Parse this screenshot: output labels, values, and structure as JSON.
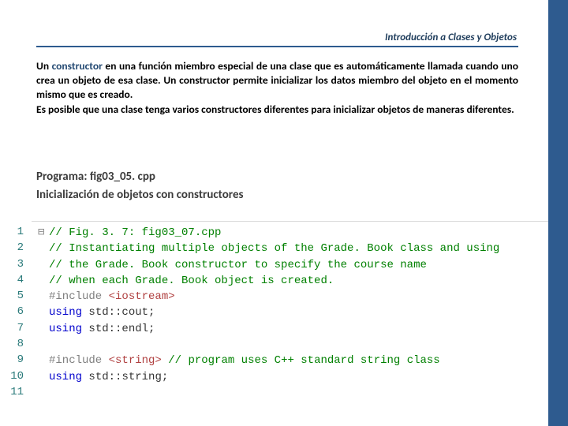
{
  "header": {
    "title": "Introducción a Clases y Objetos"
  },
  "body": {
    "p1_pre": "Un ",
    "p1_term": "constructor",
    "p1_post": " en una función miembro especial de una clase que es automáticamente llamada cuando uno crea un objeto de esa clase. Un constructor permite inicializar los datos miembro del objeto en el momento mismo que es creado.",
    "p2": "Es posible que una clase tenga varios constructores diferentes para inicializar objetos de maneras diferentes."
  },
  "program": {
    "title": "Programa: fig03_05. cpp",
    "subtitle": "Inicialización de objetos con constructores"
  },
  "code": {
    "gutter": [
      "1",
      "2",
      "3",
      "4",
      "5",
      "6",
      "7",
      "8",
      "9",
      "10",
      "11"
    ],
    "lines": [
      {
        "fold": "⊟",
        "segments": [
          {
            "cls": "comment",
            "t": "// Fig. 3. 7: fig03_07.cpp"
          }
        ]
      },
      {
        "fold": " ",
        "segments": [
          {
            "cls": "comment",
            "t": "// Instantiating multiple objects of the Grade. Book class and using"
          }
        ]
      },
      {
        "fold": " ",
        "segments": [
          {
            "cls": "comment",
            "t": "// the Grade. Book constructor to specify the course name"
          }
        ]
      },
      {
        "fold": " ",
        "segments": [
          {
            "cls": "comment",
            "t": "// when each Grade. Book object is created."
          }
        ]
      },
      {
        "fold": " ",
        "segments": [
          {
            "cls": "pp",
            "t": "#include "
          },
          {
            "cls": "str",
            "t": "<iostream>"
          }
        ]
      },
      {
        "fold": " ",
        "segments": [
          {
            "cls": "kw",
            "t": "using"
          },
          {
            "cls": "",
            "t": " std::cout;"
          }
        ]
      },
      {
        "fold": " ",
        "segments": [
          {
            "cls": "kw",
            "t": "using"
          },
          {
            "cls": "",
            "t": " std::endl;"
          }
        ]
      },
      {
        "fold": " ",
        "segments": [
          {
            "cls": "",
            "t": ""
          }
        ]
      },
      {
        "fold": " ",
        "segments": [
          {
            "cls": "pp",
            "t": "#include "
          },
          {
            "cls": "str",
            "t": "<string>"
          },
          {
            "cls": "",
            "t": " "
          },
          {
            "cls": "comment",
            "t": "// program uses C++ standard string class"
          }
        ]
      },
      {
        "fold": " ",
        "segments": [
          {
            "cls": "kw",
            "t": "using"
          },
          {
            "cls": "",
            "t": " std::"
          },
          {
            "cls": "",
            "t": "string"
          },
          {
            "cls": "",
            "t": ";"
          }
        ]
      },
      {
        "fold": " ",
        "segments": [
          {
            "cls": "",
            "t": ""
          }
        ]
      }
    ]
  }
}
